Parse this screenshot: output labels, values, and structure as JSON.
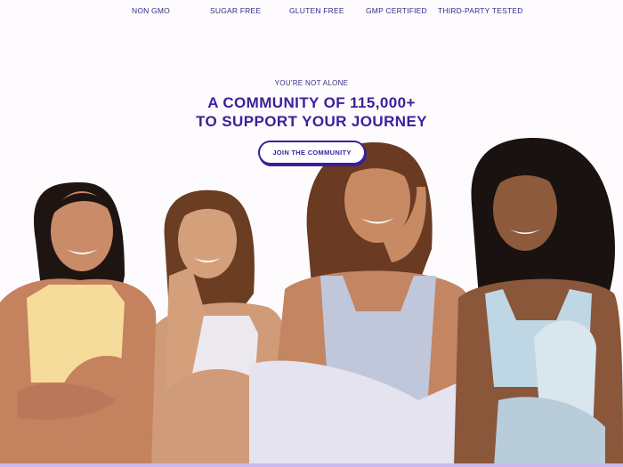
{
  "badges": [
    "NON GMO",
    "SUGAR FREE",
    "GLUTEN FREE",
    "GMP CERTIFIED",
    "THIRD-PARTY TESTED"
  ],
  "hero": {
    "eyebrow": "YOU'RE NOT ALONE",
    "headline_line1": "A COMMUNITY OF 115,000+",
    "headline_line2": "TO SUPPORT YOUR JOURNEY",
    "cta_label": "JOIN THE COMMUNITY"
  },
  "colors": {
    "brand_purple": "#3a1f9c",
    "background": "#fdfbfd",
    "bottom_bar": "#c9b7ee"
  }
}
